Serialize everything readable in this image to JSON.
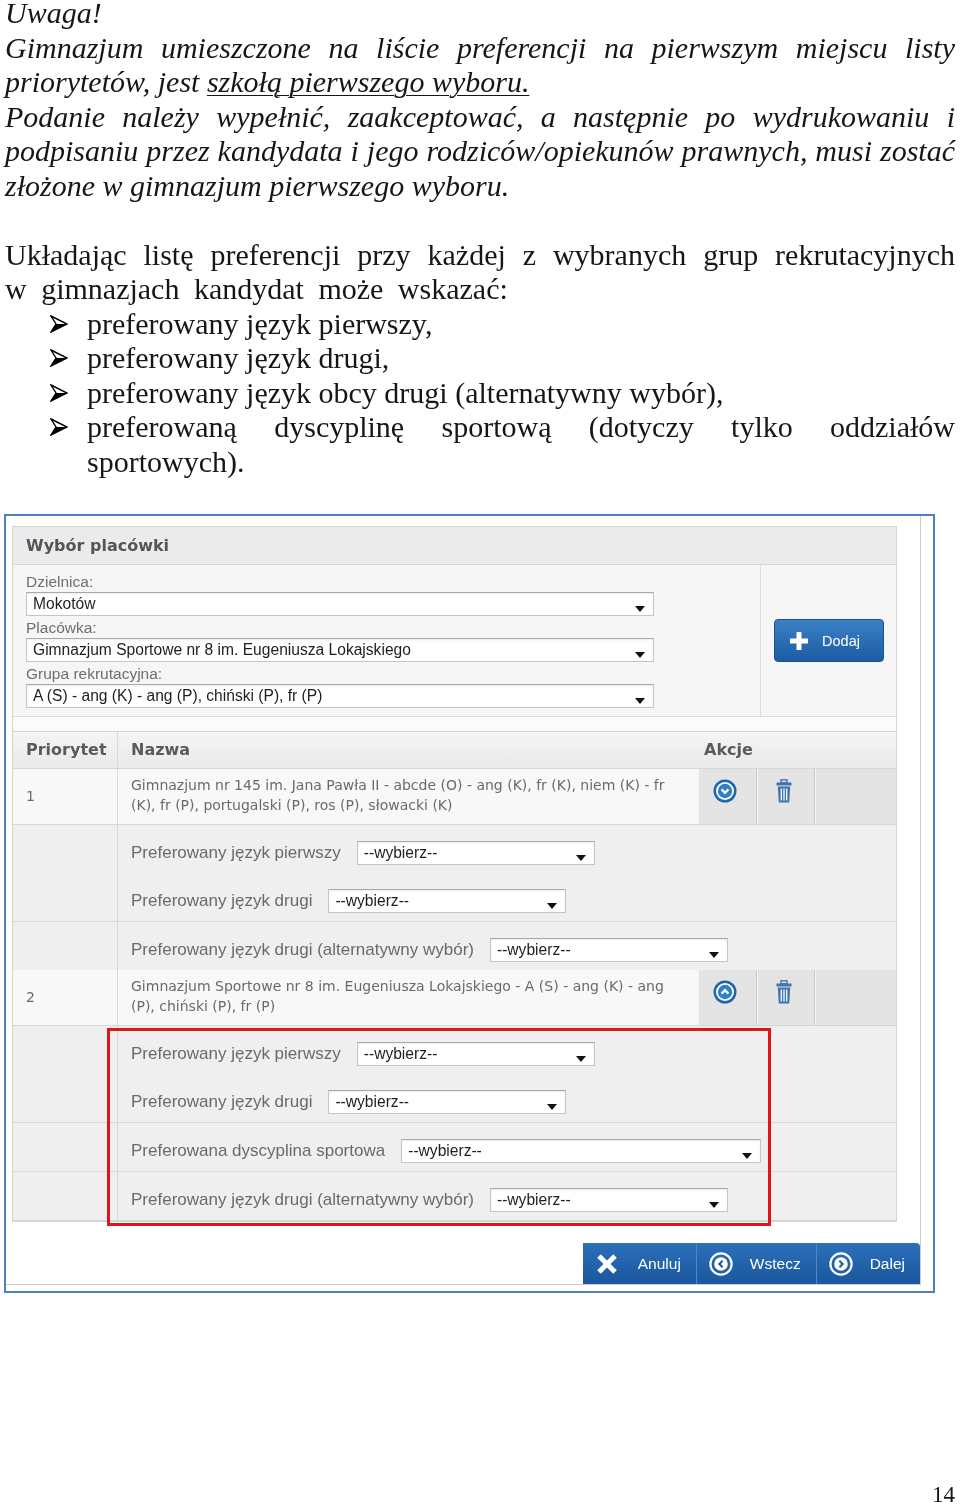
{
  "notice": {
    "title": "Uwaga!",
    "paragraphs": [
      {
        "parts": [
          {
            "text": "Gimnazjum umieszczone na liście preferencji na pierwszym miejscu listy priorytetów, jest ",
            "underline": false
          },
          {
            "text": "szkołą pierwszego wyboru.",
            "underline": true
          }
        ]
      },
      {
        "parts": [
          {
            "text": "Podanie należy wypełnić, zaakceptować, a następnie po wydrukowaniu i podpisaniu przez kandydata i jego rodziców/opiekunów prawnych, musi zostać złożone w gimnazjum pierwszego wyboru.",
            "underline": false
          }
        ]
      }
    ]
  },
  "instructions": {
    "intro": "Układając listę preferencji przy każdej z wybranych grup rekrutacyjnych w gimnazjach kandydat może wskazać:",
    "bullets": [
      "preferowany język pierwszy,",
      "preferowany język drugi,",
      "preferowany język obcy drugi (alternatywny wybór),",
      "preferowaną dyscyplinę sportową (dotyczy tylko oddziałów sportowych)."
    ]
  },
  "screenshot": {
    "panel_title": "Wybór placówki",
    "fields": [
      {
        "label": "Dzielnica:",
        "value": "Mokotów"
      },
      {
        "label": "Placówka:",
        "value": "Gimnazjum Sportowe nr 8 im. Eugeniusza Lokajskiego"
      },
      {
        "label": "Grupa rekrutacyjna:",
        "value": "A (S) - ang (K) - ang (P), chiński (P), fr (P)"
      }
    ],
    "add_button": "Dodaj",
    "table": {
      "columns": [
        "Priorytet",
        "Nazwa",
        "Akcje"
      ],
      "rows": [
        {
          "kind": "down",
          "priority": "1",
          "name": "Gimnazjum nr 145 im. Jana Pawła II - abcde (O) - ang (K), fr (K), niem (K) - fr (K), fr (P), portugalski (P), ros (P), słowacki (K)",
          "highlighted": false,
          "preference_groups": [
            {
              "fields": [
                {
                  "kind": "language",
                  "label": "Preferowany język pierwszy",
                  "value": "--wybierz--"
                },
                {
                  "kind": "language",
                  "label": "Preferowany język drugi",
                  "value": "--wybierz--"
                }
              ]
            },
            {
              "fields": [
                {
                  "kind": "language",
                  "label": "Preferowany język drugi (alternatywny wybór)",
                  "value": "--wybierz--"
                }
              ]
            }
          ]
        },
        {
          "kind": "up",
          "priority": "2",
          "name": "Gimnazjum Sportowe nr 8 im. Eugeniusza Lokajskiego - A (S) - ang (K) - ang (P), chiński (P), fr (P)",
          "highlighted": true,
          "preference_groups": [
            {
              "fields": [
                {
                  "kind": "language",
                  "label": "Preferowany język pierwszy",
                  "value": "--wybierz--"
                },
                {
                  "kind": "language",
                  "label": "Preferowany język drugi",
                  "value": "--wybierz--"
                }
              ]
            },
            {
              "fields": [
                {
                  "kind": "sport",
                  "label": "Preferowana dyscyplina sportowa",
                  "value": "--wybierz--"
                }
              ]
            },
            {
              "fields": [
                {
                  "kind": "language",
                  "label": "Preferowany język drugi (alternatywny wybór)",
                  "value": "--wybierz--"
                }
              ]
            }
          ]
        }
      ]
    },
    "buttons": [
      {
        "kind": "cancel",
        "label": "Anuluj"
      },
      {
        "kind": "back",
        "label": "Wstecz"
      },
      {
        "kind": "next",
        "label": "Dalej"
      }
    ]
  },
  "page_number": "14"
}
